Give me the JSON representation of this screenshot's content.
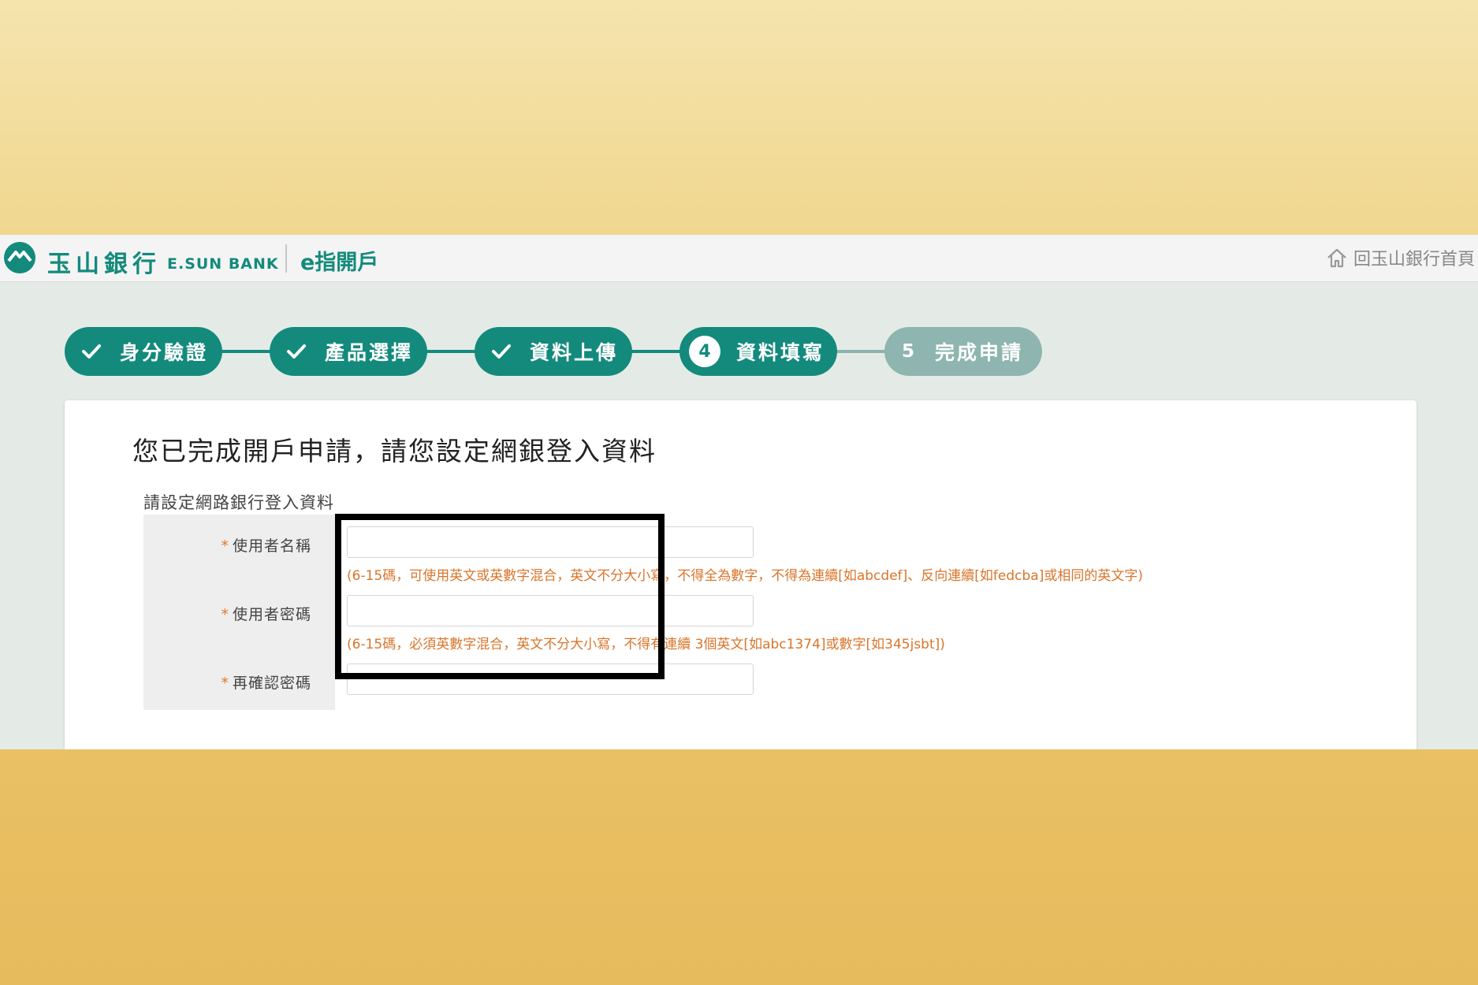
{
  "header": {
    "brand_cn": "玉山銀行",
    "brand_en": "E.SUN BANK",
    "product": "e指開戶",
    "home_link": "回玉山銀行首頁",
    "brand_color": "#138a7c"
  },
  "steps": [
    {
      "label": "身分驗證",
      "state": "done"
    },
    {
      "label": "產品選擇",
      "state": "done"
    },
    {
      "label": "資料上傳",
      "state": "done"
    },
    {
      "number": "4",
      "label": "資料填寫",
      "state": "current"
    },
    {
      "number": "5",
      "label": "完成申請",
      "state": "pending"
    }
  ],
  "card": {
    "title": "您已完成開戶申請，請您設定網銀登入資料",
    "section_label": "請設定網路銀行登入資料"
  },
  "form": {
    "required_mark": "*",
    "username": {
      "label": "使用者名稱",
      "value": "",
      "hint": "(6-15碼，可使用英文或英數字混合，英文不分大小寫，不得全為數字，不得為連續[如abcdef]、反向連續[如fedcba]或相同的英文字)"
    },
    "password": {
      "label": "使用者密碼",
      "value": "",
      "hint": "(6-15碼，必須英數字混合，英文不分大小寫，不得有連續 3個英文[如abc1374]或數字[如345jsbt])"
    },
    "confirm": {
      "label": "再確認密碼",
      "value": ""
    }
  },
  "icons": {
    "logo": "esun-mountain-logo",
    "home": "home-icon",
    "check": "check-icon"
  }
}
